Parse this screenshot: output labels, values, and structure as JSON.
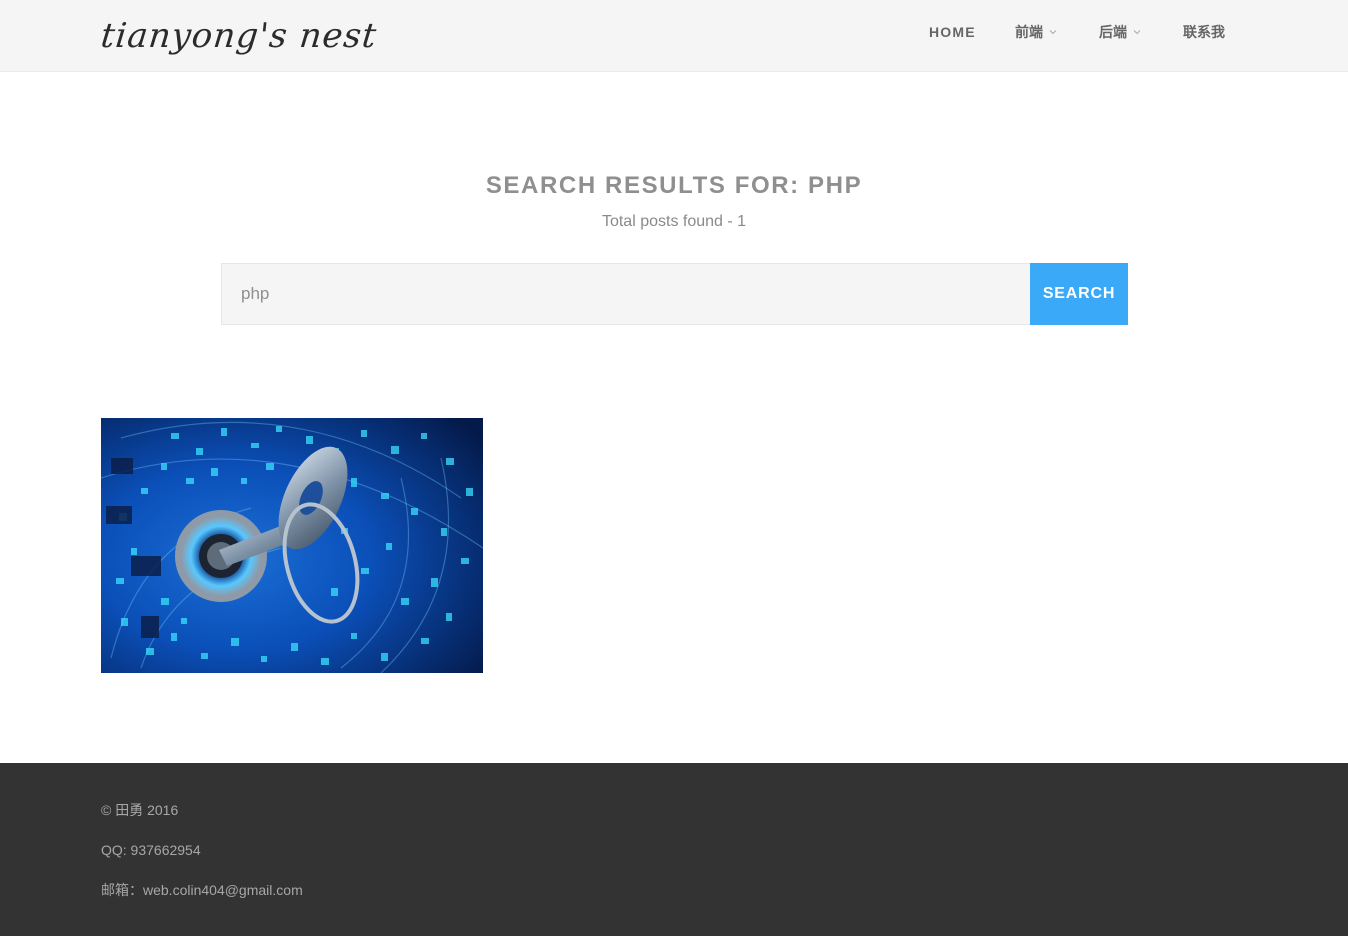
{
  "header": {
    "logo_text": "tianyong's nest",
    "nav": {
      "home": "HOME",
      "frontend": "前端",
      "backend": "后端",
      "contact": "联系我"
    }
  },
  "search": {
    "title": "SEARCH RESULTS FOR: PHP",
    "count_text": "Total posts found - 1",
    "query": "php",
    "button_label": "SEARCH"
  },
  "results": {
    "thumbnail_subject": "key-in-lock-digital-security-image"
  },
  "footer": {
    "copyright": "© 田勇 2016",
    "qq": "QQ: 937662954",
    "email_label": "邮箱：",
    "email": "web.colin404@gmail.com"
  },
  "colors": {
    "header_bg": "#f5f5f5",
    "accent_blue": "#3aa9f8",
    "title_gray": "#8f8f8f",
    "footer_bg": "#333333",
    "footer_text": "#a7a7a7"
  }
}
